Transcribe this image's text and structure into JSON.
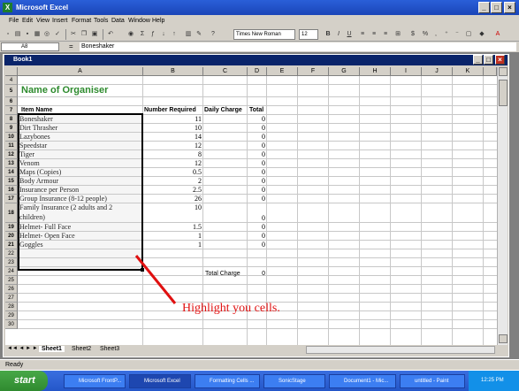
{
  "app": {
    "title": "Microsoft Excel",
    "icon": "excel-icon"
  },
  "menu": [
    "File",
    "Edit",
    "View",
    "Insert",
    "Format",
    "Tools",
    "Data",
    "Window",
    "Help"
  ],
  "toolbar": {
    "font": "Times New Roman",
    "size": "12"
  },
  "formula": {
    "cell": "A8",
    "value": "Boneshaker"
  },
  "workbook": {
    "title": "Book1"
  },
  "columns": [
    "A",
    "B",
    "C",
    "D",
    "E",
    "F",
    "G",
    "H",
    "I",
    "J",
    "K"
  ],
  "sheet": {
    "title": "Name of Organiser",
    "headers": {
      "item": "Item Name",
      "required": "Number Required",
      "charge": "Daily Charge",
      "total": "Total"
    },
    "rows": [
      {
        "n": "8",
        "item": "Boneshaker",
        "req": "11",
        "total": "0"
      },
      {
        "n": "9",
        "item": "Dirt Thrasher",
        "req": "10",
        "total": "0"
      },
      {
        "n": "10",
        "item": "Lazybones",
        "req": "14",
        "total": "0"
      },
      {
        "n": "11",
        "item": "Speedstar",
        "req": "12",
        "total": "0"
      },
      {
        "n": "12",
        "item": "Tiger",
        "req": "8",
        "total": "0"
      },
      {
        "n": "13",
        "item": "Venom",
        "req": "12",
        "total": "0"
      },
      {
        "n": "14",
        "item": "Maps (Copies)",
        "req": "0.5",
        "total": "0"
      },
      {
        "n": "15",
        "item": "Body Armour",
        "req": "2",
        "total": "0"
      },
      {
        "n": "16",
        "item": "Insurance per Person",
        "req": "2.5",
        "total": "0"
      },
      {
        "n": "17",
        "item": "Group Insurance (8-12 people)",
        "req": "26",
        "total": "0"
      },
      {
        "n": "18",
        "item": "Family Insurance (2 adults and 2",
        "item2": "children)",
        "req": "10",
        "total": "0"
      },
      {
        "n": "19",
        "item": "Helmet- Full Face",
        "req": "1.5",
        "total": "0"
      },
      {
        "n": "20",
        "item": "Helmet- Open Face",
        "req": "1",
        "total": "0"
      },
      {
        "n": "21",
        "item": "Goggles",
        "req": "1",
        "total": "0"
      }
    ],
    "total_charge_label": "Total Charge",
    "total_charge_value": "0"
  },
  "annotation": "Highlight you cells.",
  "tabs": [
    "Sheet1",
    "Sheet2",
    "Sheet3"
  ],
  "status": "Ready",
  "taskbar": {
    "start": "start",
    "items": [
      "Microsoft FrontP...",
      "Microsoft Excel",
      "Formatting Cells ...",
      "SonicStage",
      "Document1 - Mic...",
      "untitled - Paint"
    ],
    "time": "12:25 PM"
  },
  "colors": {
    "title_green": "#2e8b2e",
    "annotation_red": "#e01010",
    "selection_border": "#000000"
  }
}
